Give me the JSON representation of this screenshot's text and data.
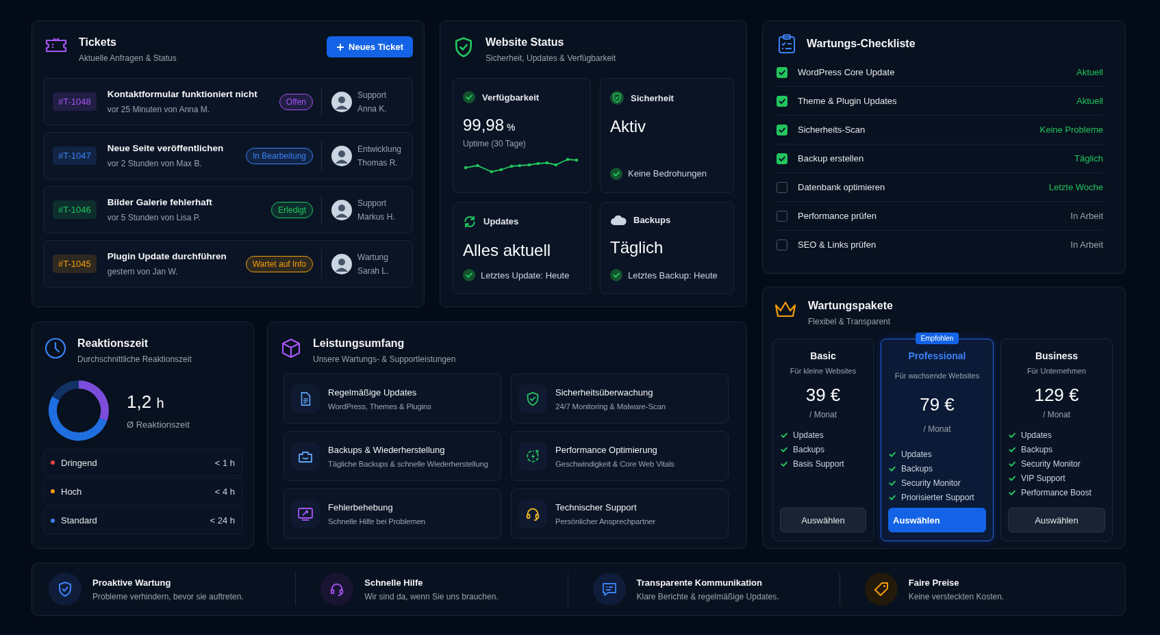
{
  "tickets": {
    "title": "Tickets",
    "subtitle": "Aktuelle Anfragen & Status",
    "button": "Neues Ticket",
    "items": [
      {
        "id": "#T-1048",
        "title": "Kontaktformular funktioniert nicht",
        "meta": "vor 25 Minuten von Anna M.",
        "status": "Offen",
        "color": "#a855f7",
        "team": "Support",
        "assignee": "Anna K."
      },
      {
        "id": "#T-1047",
        "title": "Neue Seite veröffentlichen",
        "meta": "vor 2 Stunden von Max B.",
        "status": "In Bearbeitung",
        "color": "#3b82f6",
        "team": "Entwicklung",
        "assignee": "Thomas R."
      },
      {
        "id": "#T-1046",
        "title": "Bilder Galerie fehlerhaft",
        "meta": "vor 5 Stunden von Lisa P.",
        "status": "Erledigt",
        "color": "#22c55e",
        "team": "Support",
        "assignee": "Markus H."
      },
      {
        "id": "#T-1045",
        "title": "Plugin Update durchführen",
        "meta": "gestern von Jan W.",
        "status": "Wartet auf Info",
        "color": "#f59e0b",
        "team": "Wartung",
        "assignee": "Sarah L."
      }
    ]
  },
  "website_status": {
    "title": "Website Status",
    "subtitle": "Sicherheit, Updates & Verfügbarkeit",
    "tiles": [
      {
        "kind": "uptime",
        "label": "Verfügbarkeit",
        "value": "99,98",
        "unit": "%",
        "caption": "Uptime (30 Tage)"
      },
      {
        "kind": "status",
        "label": "Sicherheit",
        "value": "Aktiv",
        "note": "Keine Bedrohungen"
      },
      {
        "kind": "status",
        "label": "Updates",
        "value": "Alles aktuell",
        "note": "Letztes Update: Heute"
      },
      {
        "kind": "status",
        "label": "Backups",
        "value": "Täglich",
        "note": "Letztes Backup: Heute"
      }
    ]
  },
  "checklist": {
    "title": "Wartungs-Checkliste",
    "items": [
      {
        "label": "WordPress Core Update",
        "checked": true,
        "status": "Aktuell",
        "color": "#22c55e"
      },
      {
        "label": "Theme & Plugin Updates",
        "checked": true,
        "status": "Aktuell",
        "color": "#22c55e"
      },
      {
        "label": "Sicherheits-Scan",
        "checked": true,
        "status": "Keine Probleme",
        "color": "#22c55e"
      },
      {
        "label": "Backup erstellen",
        "checked": true,
        "status": "Täglich",
        "color": "#22c55e"
      },
      {
        "label": "Datenbank optimieren",
        "checked": false,
        "status": "Letzte Woche",
        "color": "#22c55e"
      },
      {
        "label": "Performance prüfen",
        "checked": false,
        "status": "In Arbeit",
        "color": "#9ca3af"
      },
      {
        "label": "SEO & Links prüfen",
        "checked": false,
        "status": "In Arbeit",
        "color": "#9ca3af"
      }
    ]
  },
  "response_time": {
    "title": "Reaktionszeit",
    "subtitle": "Durchschnittliche Reaktionszeit",
    "value": "1,2",
    "unit": "h",
    "caption": "Ø Reaktionszeit",
    "levels": [
      {
        "label": "Dringend",
        "time": "< 1 h",
        "color": "#ef4444"
      },
      {
        "label": "Hoch",
        "time": "< 4 h",
        "color": "#f59e0b"
      },
      {
        "label": "Standard",
        "time": "< 24 h",
        "color": "#3b82f6"
      }
    ]
  },
  "services": {
    "title": "Leistungsumfang",
    "subtitle": "Unsere Wartungs- & Supportleistungen",
    "items": [
      {
        "title": "Regelmäßige Updates",
        "text": "WordPress, Themes & Plugins"
      },
      {
        "title": "Sicherheitsüberwachung",
        "text": "24/7 Monitoring & Malware-Scan"
      },
      {
        "title": "Backups & Wiederherstellung",
        "text": "Tägliche Backups & schnelle Wiederherstellung"
      },
      {
        "title": "Performance Optimierung",
        "text": "Geschwindigkeit & Core Web Vitals"
      },
      {
        "title": "Fehlerbehebung",
        "text": "Schnelle Hilfe bei Problemen"
      },
      {
        "title": "Technischer Support",
        "text": "Persönlicher Ansprechpartner"
      }
    ]
  },
  "packages": {
    "title": "Wartungspakete",
    "subtitle": "Flexibel & Transparent",
    "plans": [
      {
        "name": "Basic",
        "subtitle": "Für kleine Websites",
        "price": "39 €",
        "period": "/ Monat",
        "features": [
          "Updates",
          "Backups",
          "Basis Support"
        ],
        "button": "Auswählen",
        "featured": false
      },
      {
        "name": "Professional",
        "subtitle": "Für wachsende Websites",
        "price": "79 €",
        "period": "/ Monat",
        "features": [
          "Updates",
          "Backups",
          "Security Monitor",
          "Priorisierter Support"
        ],
        "button": "Auswählen",
        "featured": true,
        "badge": "Empfohlen"
      },
      {
        "name": "Business",
        "subtitle": "Für Unternehmen",
        "price": "129 €",
        "period": "/ Monat",
        "features": [
          "Updates",
          "Backups",
          "Security Monitor",
          "VIP Support",
          "Performance Boost"
        ],
        "button": "Auswählen",
        "featured": false
      }
    ]
  },
  "benefits": [
    {
      "title": "Proaktive Wartung",
      "text": "Probleme verhindern, bevor sie auftreten."
    },
    {
      "title": "Schnelle Hilfe",
      "text": "Wir sind da, wenn Sie uns brauchen."
    },
    {
      "title": "Transparente Kommunikation",
      "text": "Klare Berichte & regelmäßige Updates."
    },
    {
      "title": "Faire Preise",
      "text": "Keine versteckten Kosten."
    }
  ]
}
